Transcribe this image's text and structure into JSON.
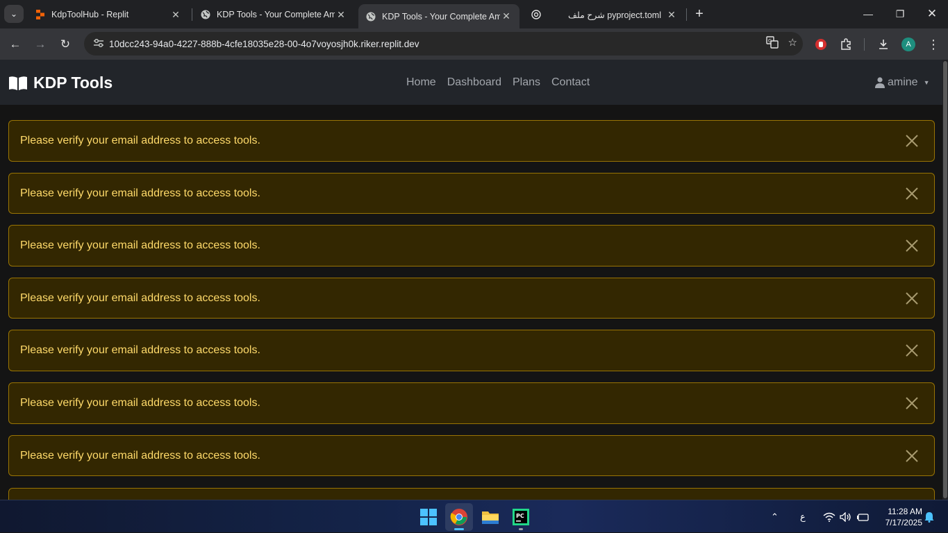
{
  "browser": {
    "tabs": [
      {
        "title": "KdpToolHub - Replit",
        "active": false
      },
      {
        "title": "KDP Tools - Your Complete Ama",
        "active": false
      },
      {
        "title": "KDP Tools - Your Complete Ama",
        "active": true
      },
      {
        "title": "شرح ملف pyproject.toml",
        "active": false
      }
    ],
    "url": "10dcc243-94a0-4227-888b-4cfe18035e28-00-4o7voyosjh0k.riker.replit.dev",
    "profile_initial": "A"
  },
  "site": {
    "brand": "KDP Tools",
    "nav": [
      "Home",
      "Dashboard",
      "Plans",
      "Contact"
    ],
    "user": "amine"
  },
  "alerts": [
    "Please verify your email address to access tools.",
    "Please verify your email address to access tools.",
    "Please verify your email address to access tools.",
    "Please verify your email address to access tools.",
    "Please verify your email address to access tools.",
    "Please verify your email address to access tools.",
    "Please verify your email address to access tools.",
    ""
  ],
  "taskbar": {
    "language": "ع",
    "time": "11:28 AM",
    "date": "7/17/2025"
  },
  "colors": {
    "alert_bg": "#332701",
    "alert_border": "#997404",
    "alert_text": "#ffda6a",
    "navbar_bg": "#22252a"
  }
}
